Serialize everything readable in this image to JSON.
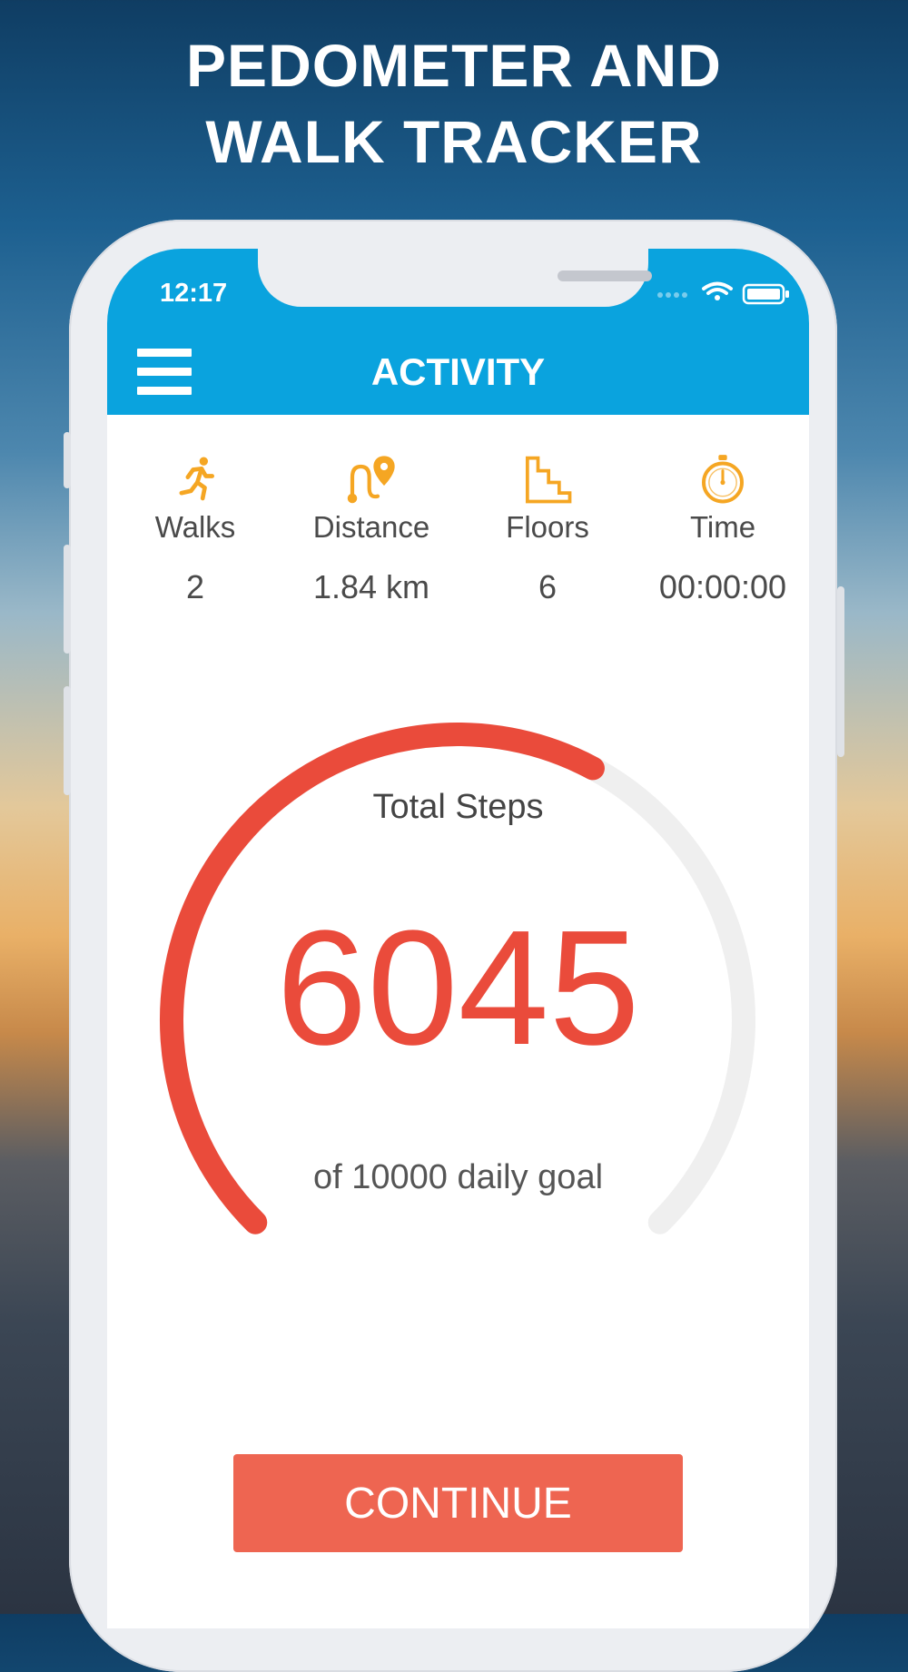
{
  "hero": {
    "title": "PEDOMETER AND\nWALK TRACKER"
  },
  "status_bar": {
    "time": "12:17"
  },
  "header": {
    "title": "ACTIVITY"
  },
  "stats": [
    {
      "icon": "runner-icon",
      "label": "Walks",
      "value": "2"
    },
    {
      "icon": "route-icon",
      "label": "Distance",
      "value": "1.84 km"
    },
    {
      "icon": "stairs-icon",
      "label": "Floors",
      "value": "6"
    },
    {
      "icon": "stopwatch-icon",
      "label": "Time",
      "value": "00:00:00"
    }
  ],
  "steps": {
    "label": "Total Steps",
    "value": "6045",
    "goal_text": "of 10000 daily goal",
    "count": 6045,
    "goal": 10000
  },
  "actions": {
    "continue_label": "CONTINUE"
  },
  "colors": {
    "appbar": "#0aa3de",
    "accent": "#ea4b3b",
    "icon": "#f5a623",
    "button": "#ee6551",
    "track": "#efefef"
  }
}
